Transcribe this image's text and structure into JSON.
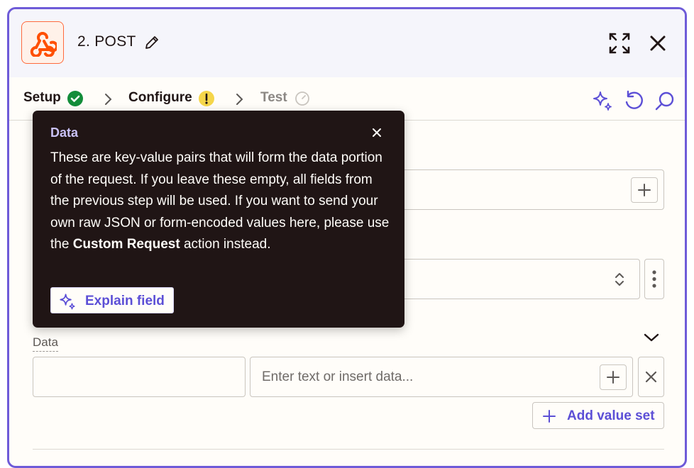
{
  "header": {
    "title": "2. POST",
    "app_icon": "webhook-icon",
    "accent_color": "#ff4f00"
  },
  "steps": [
    {
      "label": "Setup",
      "status": "complete"
    },
    {
      "label": "Configure",
      "status": "warning"
    },
    {
      "label": "Test",
      "status": "pending"
    }
  ],
  "toolbar": {
    "icons": [
      "sparkle-icon",
      "undo-icon",
      "search-icon"
    ]
  },
  "data_section": {
    "label": "Data",
    "value_placeholder": "Enter text or insert data...",
    "add_value_set_label": "Add value set"
  },
  "tooltip": {
    "title": "Data",
    "body_before": "These are key-value pairs that will form the data portion of the request. If you leave these empty, all fields from the previous step will be used. If you want to send your own raw JSON or form-encoded values here, please use the ",
    "body_bold": "Custom Request",
    "body_after": " action instead.",
    "explain_label": "Explain field"
  },
  "colors": {
    "frame_border": "#6e5bd8",
    "brand_purple": "#5c4fd6",
    "success_green": "#138d3a",
    "warning_yellow": "#f5d64a"
  }
}
